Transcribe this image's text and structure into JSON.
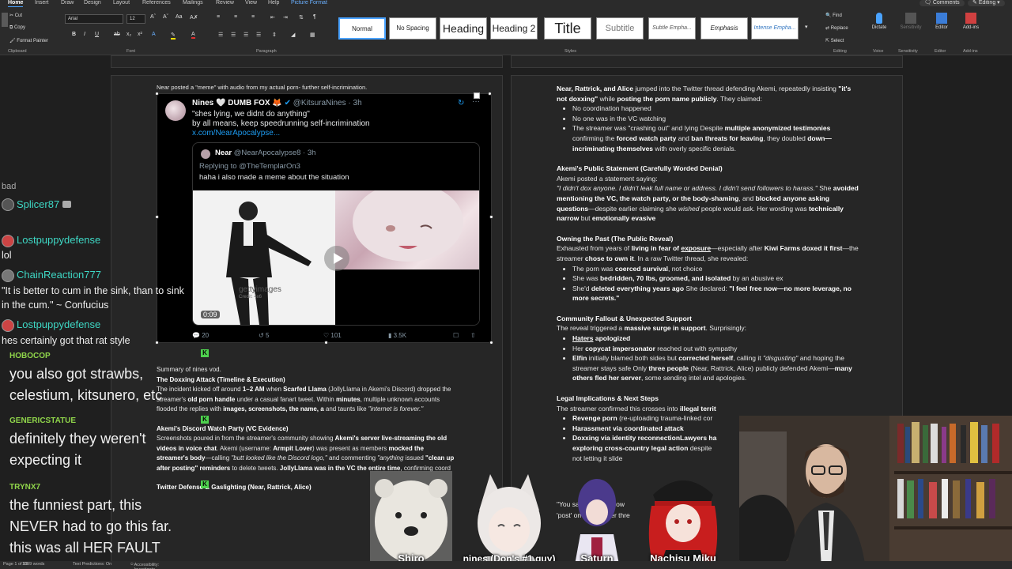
{
  "ribbon": {
    "menu": [
      "Home",
      "Insert",
      "Draw",
      "Design",
      "Layout",
      "References",
      "Mailings",
      "Review",
      "View",
      "Help",
      "Picture Format"
    ],
    "comments_label": "Comments",
    "editing_mode_label": "Editing",
    "clipboard": {
      "cut": "Cut",
      "copy": "Copy",
      "format_painter": "Format Painter",
      "group_label": "Clipboard"
    },
    "font": {
      "name": "Arial",
      "size": "12",
      "group_label": "Font"
    },
    "paragraph": {
      "group_label": "Paragraph"
    },
    "styles": {
      "items": [
        "Normal",
        "No Spacing",
        "Heading",
        "Heading 2",
        "Title",
        "Subtitle",
        "Subtle Empha...",
        "Emphasis",
        "Intense Empha..."
      ],
      "group_label": "Styles"
    },
    "editing": {
      "find": "Find",
      "replace": "Replace",
      "select": "Select",
      "group_label": "Editing"
    },
    "voice": {
      "dictate": "Dictate",
      "group_label": "Voice"
    },
    "sensitivity": {
      "label": "Sensitivity",
      "group_label": "Sensitivity"
    },
    "editor": {
      "label": "Editor",
      "group_label": "Editor"
    },
    "addins": {
      "label": "Add-ins",
      "group_label": "Add-ins"
    }
  },
  "doc_left": {
    "caption": "Near posted a \"meme\" with audio from my actual porn- further self-incrimination.",
    "tweet": {
      "name": "Nines",
      "subname": "DUMB FOX",
      "handle": "@KitsuraNines · 3h",
      "text_line1": "\"shes lying, we didnt do anything\"",
      "text_line2": "by all means, keep speedrunning self-incrimination",
      "link": "x.com/NearApocalypse...",
      "quote": {
        "name": "Near",
        "handle": "@NearApocalypse8 · 3h",
        "replying": "Replying to @TheTemplarOn3",
        "text": "haha i also made a meme about the situation",
        "video_time": "0:09",
        "watermark": "gettyimages",
        "watermark_credit": "Credit: 4x6"
      },
      "stats": {
        "replies": "20",
        "retweets": "5",
        "likes": "101",
        "views": "3.5K"
      }
    },
    "summary_label": "Summary of nines vod.",
    "heading1": "The Doxxing Attack (Timeline & Execution)",
    "para1_a": "The incident kicked off around",
    "para1_b": "1–2 AM",
    "para1_c": "when",
    "para1_d": "Scarfed Llama",
    "para1_e": "(JollyLlama in Akemi's Discord) dropped the streamer's",
    "para1_f": "old porn handle",
    "para1_g": "under a casual fanart tweet. Within",
    "para1_h": "minutes",
    "para1_i": ", multiple unknown accounts flooded the replies with",
    "para1_j": "images, screenshots, the name, a",
    "para1_k": "and taunts",
    "para1_l": "like",
    "para1_m": "\"internet is forever.\"",
    "heading2": "Akemi's Discord Watch Party (VC Evidence)",
    "para2_a": "Screenshots poured in from the streamer's community showing",
    "para2_b": "Akemi's server live-streaming the old videos in voice chat",
    "para2_c": ". Akemi (username:",
    "para2_d": "Armpit Lover",
    "para2_e": ") was present as members",
    "para2_f": "mocked the streamer's body",
    "para2_g": "—calling",
    "para2_h": "\"butt looked like the Discord logo,\"",
    "para2_i": "and commenting",
    "para2_j": "\"anything",
    "para2_k": "issued",
    "para2_l": "\"clean up after posting\" reminders",
    "para2_m": "to delete tweets.",
    "para2_n": "JollyLlama was in the VC the entire time",
    "para2_o": ", confirming coord",
    "heading3": "Twitter Defense & Gaslighting (Near, Rattrick, Alice)"
  },
  "doc_right": {
    "intro_a": "Near, Rattrick, and Alice",
    "intro_b": "jumped into the Twitter thread defending Akemi, repeatedly insisting",
    "intro_c": "\"it's not doxxing\"",
    "intro_d": "while",
    "intro_e": "posting the porn name publicly",
    "intro_f": ". They claimed:",
    "claims": [
      "No coordination happened",
      "No one was in the VC watching"
    ],
    "claim3_a": "The streamer was \"crashing out\" and lying Despite",
    "claim3_b": "multiple anonymized testimonies",
    "claim3_c": "confirming the",
    "claim3_d": "forced watch party",
    "claim3_e": "and",
    "claim3_f": "ban threats for leaving",
    "claim3_g": ", they doubled",
    "claim3_h": "down—incriminating themselves",
    "claim3_i": "with overly specific denials.",
    "heading_statement": "Akemi's Public Statement (Carefully Worded Denial)",
    "statement_a": "Akemi posted a statement saying:",
    "statement_quote": "\"I didn't dox anyone. I didn't leak full name or address. I didn't send followers to harass.\"",
    "statement_b": "She",
    "statement_c": "avoided mentioning the VC, the watch party, or the body-shaming",
    "statement_d": ", and",
    "statement_e": "blocked anyone asking questions",
    "statement_f": "—despite earlier claiming she",
    "statement_g": "wished",
    "statement_h": "people would ask. Her wording was",
    "statement_i": "technically narrow",
    "statement_j": "but",
    "statement_k": "emotionally evasive",
    "heading_owning": "Owning the Past (The Public Reveal)",
    "owning_a": "Exhausted from years of",
    "owning_b": "living in fear of",
    "owning_c": "exposure",
    "owning_d": "—especially after",
    "owning_e": "Kiwi Farms doxed it first",
    "owning_f": "—the streamer",
    "owning_g": "chose to own it",
    "owning_h": ". In a raw Twitter thread, she revealed:",
    "owning_list1_a": "The porn was",
    "owning_list1_b": "coerced survival",
    "owning_list1_c": ", not choice",
    "owning_list2_a": "She was",
    "owning_list2_b": "bedridden, 70 lbs, groomed, and isolated",
    "owning_list2_c": "by an abusive ex",
    "owning_list3_a": "She'd",
    "owning_list3_b": "deleted everything years ago",
    "owning_list3_c": "She declared:",
    "owning_list3_d": "\"I feel free now—no more leverage, no more secrets.\"",
    "heading_community": "Community Fallout & Unexpected Support",
    "community_a": "The reveal triggered a",
    "community_b": "massive surge in support",
    "community_c": ". Surprisingly:",
    "community_list1_a": "Haters",
    "community_list1_b": "apologized",
    "community_list2_a": "Her",
    "community_list2_b": "copycat impersonator",
    "community_list2_c": "reached out with sympathy",
    "community_list3_a": "Elfin",
    "community_list3_b": "initially blamed both sides but",
    "community_list3_c": "corrected herself",
    "community_list3_d": ", calling it",
    "community_list3_e": "\"disgusting\"",
    "community_list3_f": "and hoping the streamer stays safe Only",
    "community_list3_g": "three people",
    "community_list3_h": "(Near, Rattrick, Alice) publicly defended Akemi—",
    "community_list3_i": "many others fled her server",
    "community_list3_j": ", some sending intel and apologies.",
    "heading_legal": "Legal Implications & Next Steps",
    "legal_a": "The streamer confirmed this crosses into",
    "legal_b": "illegal territ",
    "legal_list1_a": "Revenge porn",
    "legal_list1_b": "(re-uploading trauma-linked cor",
    "legal_list2": "Harassment via coordinated attack",
    "legal_list3_a": "Doxxing via identity reconnection",
    "legal_list3_b": "Lawyers ha",
    "legal_list3_c": "exploring cross-country legal action",
    "legal_list3_d": "despite",
    "legal_list3_e": "not letting it slide",
    "quote_tail_a": "\"You said",
    "quote_tail_b": "e now",
    "quote_tail_c": "'post' on t",
    "quote_tail_d": "ter thre"
  },
  "chat": {
    "partial_top": "bad",
    "m1_name": "Splicer87",
    "m2_name": "Lostpuppydefense",
    "m2_text": "lol",
    "m3_name": "ChainReaction777",
    "m3_text_line1": "\"It is better to cum in the sink, than to sink",
    "m3_text_line2": "in the cum.\" ~ Confucius",
    "m4_name": "Lostpuppydefense",
    "m4_text": "hes certainly got that rat style",
    "b1_name": "HOBOCOP",
    "b1_text_line1": "you also got strawbs,",
    "b1_text_line2": "celestium, kitsunero, etc",
    "b2_name": "GENERICSTATUE",
    "b2_text_line1": "definitely they weren't",
    "b2_text_line2": "expecting it",
    "b3_name": "TRYNX7",
    "b3_text_line1": "the funniest part, this",
    "b3_text_line2": "NEVER had to go this far.",
    "b3_text_line3": "this was all HER FAULT"
  },
  "avatars": [
    {
      "name": "Shiro"
    },
    {
      "name": "nines (Don's #1 guy)"
    },
    {
      "name": "Saturn"
    },
    {
      "name": "Nachisu Miku"
    }
  ],
  "status": {
    "page": "Page 1 of 19",
    "words": "1099 words",
    "text_predictions": "Text Predictions: On",
    "accessibility": "Accessibility: Investigate"
  },
  "colors": {
    "accent": "#4aa3ff",
    "chat_name": "#3ed8c5",
    "badge_name": "#8fd44a",
    "twitter_blue": "#1d9bf0"
  }
}
